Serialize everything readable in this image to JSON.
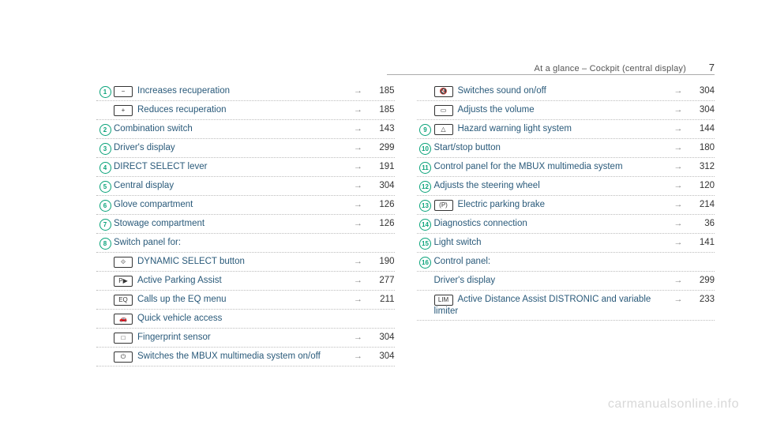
{
  "header": {
    "section": "At a glance – Cockpit (central display)",
    "page_number": "7"
  },
  "arrow": "→",
  "columns": [
    [
      {
        "num": "1",
        "icon": "−",
        "label": "Increases recuperation",
        "page": "185"
      },
      {
        "num": "",
        "icon": "+",
        "label": "Reduces recuperation",
        "page": "185"
      },
      {
        "num": "2",
        "icon": "",
        "label": "Combination switch",
        "page": "143"
      },
      {
        "num": "3",
        "icon": "",
        "label": "Driver's display",
        "page": "299"
      },
      {
        "num": "4",
        "icon": "",
        "label": "DIRECT SELECT lever",
        "page": "191"
      },
      {
        "num": "5",
        "icon": "",
        "label": "Central display",
        "page": "304"
      },
      {
        "num": "6",
        "icon": "",
        "label": "Glove compartment",
        "page": "126"
      },
      {
        "num": "7",
        "icon": "",
        "label": "Stowage compartment",
        "page": "126"
      },
      {
        "num": "8",
        "icon": "",
        "label": "Switch panel for:",
        "page": "",
        "noarrow": true
      },
      {
        "num": "",
        "icon": "⟐",
        "label": "DYNAMIC SELECT button",
        "page": "190",
        "sub": true
      },
      {
        "num": "",
        "icon": "P▶",
        "label": "Active Parking Assist",
        "page": "277",
        "sub": true
      },
      {
        "num": "",
        "icon": "EQ",
        "label": "Calls up the EQ menu",
        "page": "211",
        "sub": true
      },
      {
        "num": "",
        "icon": "🚗",
        "label": "Quick vehicle access",
        "page": "",
        "sub": true,
        "noarrow": true
      },
      {
        "num": "",
        "icon": "□",
        "label": "Fingerprint sensor",
        "page": "304",
        "sub": true
      },
      {
        "num": "",
        "icon": "⏻",
        "label": "Switches the MBUX multimedia system on/off",
        "page": "304",
        "sub": true
      }
    ],
    [
      {
        "num": "",
        "icon": "🔇",
        "label": "Switches sound on/off",
        "page": "304",
        "sub": true
      },
      {
        "num": "",
        "icon": "▭",
        "label": "Adjusts the volume",
        "page": "304",
        "sub": true
      },
      {
        "num": "9",
        "icon": "△",
        "label": "Hazard warning light system",
        "page": "144"
      },
      {
        "num": "10",
        "icon": "",
        "label": "Start/stop button",
        "page": "180"
      },
      {
        "num": "11",
        "icon": "",
        "label": "Control panel for the MBUX multimedia system",
        "page": "312"
      },
      {
        "num": "12",
        "icon": "",
        "label": "Adjusts the steering wheel",
        "page": "120"
      },
      {
        "num": "13",
        "icon": "(P)",
        "label": "Electric parking brake",
        "page": "214"
      },
      {
        "num": "14",
        "icon": "",
        "label": "Diagnostics connection",
        "page": "36"
      },
      {
        "num": "15",
        "icon": "",
        "label": "Light switch",
        "page": "141"
      },
      {
        "num": "16",
        "icon": "",
        "label": "Control panel:",
        "page": "",
        "noarrow": true
      },
      {
        "num": "",
        "icon": "",
        "label": "Driver's display",
        "page": "299",
        "sub": true
      },
      {
        "num": "",
        "icon": "LIM",
        "label": "Active Distance Assist DISTRONIC and variable limiter",
        "page": "233",
        "sub": true
      }
    ]
  ],
  "watermark": "carmanualsonline.info"
}
